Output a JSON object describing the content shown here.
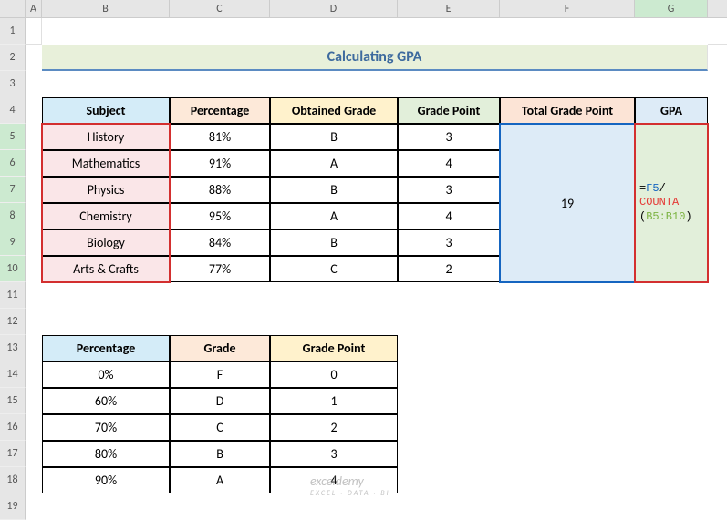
{
  "columns": [
    "A",
    "B",
    "C",
    "D",
    "E",
    "F",
    "G"
  ],
  "rows": [
    "1",
    "2",
    "3",
    "4",
    "5",
    "6",
    "7",
    "8",
    "9",
    "10",
    "11",
    "12",
    "13",
    "14",
    "15",
    "16",
    "17",
    "18",
    "19"
  ],
  "title": "Calculating GPA",
  "headers": {
    "subject": "Subject",
    "percentage": "Percentage",
    "obtained": "Obtained Grade",
    "gradepoint": "Grade Point",
    "total": "Total Grade Point",
    "gpa": "GPA"
  },
  "subjects": [
    {
      "name": "History",
      "pct": "81%",
      "grade": "B",
      "gp": "3"
    },
    {
      "name": "Mathematics",
      "pct": "91%",
      "grade": "A",
      "gp": "4"
    },
    {
      "name": "Physics",
      "pct": "88%",
      "grade": "B",
      "gp": "3"
    },
    {
      "name": "Chemistry",
      "pct": "95%",
      "grade": "A",
      "gp": "4"
    },
    {
      "name": "Biology",
      "pct": "84%",
      "grade": "B",
      "gp": "3"
    },
    {
      "name": "Arts & Crafts",
      "pct": "77%",
      "grade": "C",
      "gp": "2"
    }
  ],
  "totalGP": "19",
  "formula": {
    "p1": "=",
    "p2": "F5",
    "p3": "/",
    "p4": "COUNTA",
    "p5": "(",
    "p6": "B5:B10",
    "p7": ")"
  },
  "lookup": {
    "headers": {
      "pct": "Percentage",
      "grade": "Grade",
      "gp": "Grade Point"
    },
    "rows": [
      {
        "pct": "0%",
        "grade": "F",
        "gp": "0"
      },
      {
        "pct": "60%",
        "grade": "D",
        "gp": "1"
      },
      {
        "pct": "70%",
        "grade": "C",
        "gp": "2"
      },
      {
        "pct": "80%",
        "grade": "B",
        "gp": "3"
      },
      {
        "pct": "90%",
        "grade": "A",
        "gp": "4"
      }
    ]
  },
  "watermark": {
    "brand": "exceldemy",
    "sub": "EXCEL · DATA · BI"
  }
}
